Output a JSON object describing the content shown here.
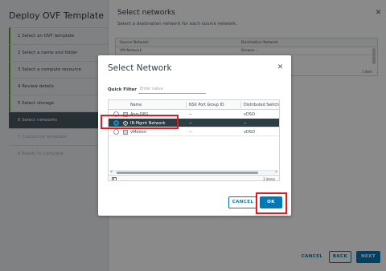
{
  "wizard": {
    "title": "Deploy OVF Template",
    "steps": [
      {
        "label": "1  Select an OVF template",
        "state": "done"
      },
      {
        "label": "2  Select a name and folder",
        "state": "done"
      },
      {
        "label": "3  Select a compute resource",
        "state": "done"
      },
      {
        "label": "4  Review details",
        "state": "done"
      },
      {
        "label": "5  Select storage",
        "state": "done"
      },
      {
        "label": "6  Select networks",
        "state": "active"
      },
      {
        "label": "7  Customize template",
        "state": "future"
      },
      {
        "label": "8  Ready to complete",
        "state": "future"
      }
    ],
    "main_title": "Select networks",
    "main_subtitle": "Select a destination network for each source network.",
    "mapping_table": {
      "columns": [
        "Source Network",
        "Destination Network"
      ],
      "rows": [
        [
          "VM Network",
          "Browse ..."
        ]
      ],
      "items": "1 item"
    },
    "buttons": {
      "cancel": "CANCEL",
      "back": "BACK",
      "next": "NEXT"
    }
  },
  "modal": {
    "title": "Select Network",
    "quick_filter_label": "Quick Filter",
    "quick_filter_placeholder": "Enter value",
    "columns": [
      "Name",
      "NSX Port Group ID",
      "Distributed Switch"
    ],
    "rows": [
      {
        "name": "App-DPG",
        "nsx": "--",
        "switch": "vDSO",
        "selected": false
      },
      {
        "name": "IB-Mgmt Network",
        "nsx": "--",
        "switch": "--",
        "selected": true
      },
      {
        "name": "vMotion",
        "nsx": "--",
        "switch": "vDSO",
        "selected": false
      }
    ],
    "items_count": "3 items",
    "buttons": {
      "cancel": "CANCEL",
      "ok": "OK"
    }
  },
  "colors": {
    "accent": "#0079b8",
    "highlight": "#e11a22",
    "selected_row": "#2e3c43",
    "step_done": "#5aa220"
  }
}
